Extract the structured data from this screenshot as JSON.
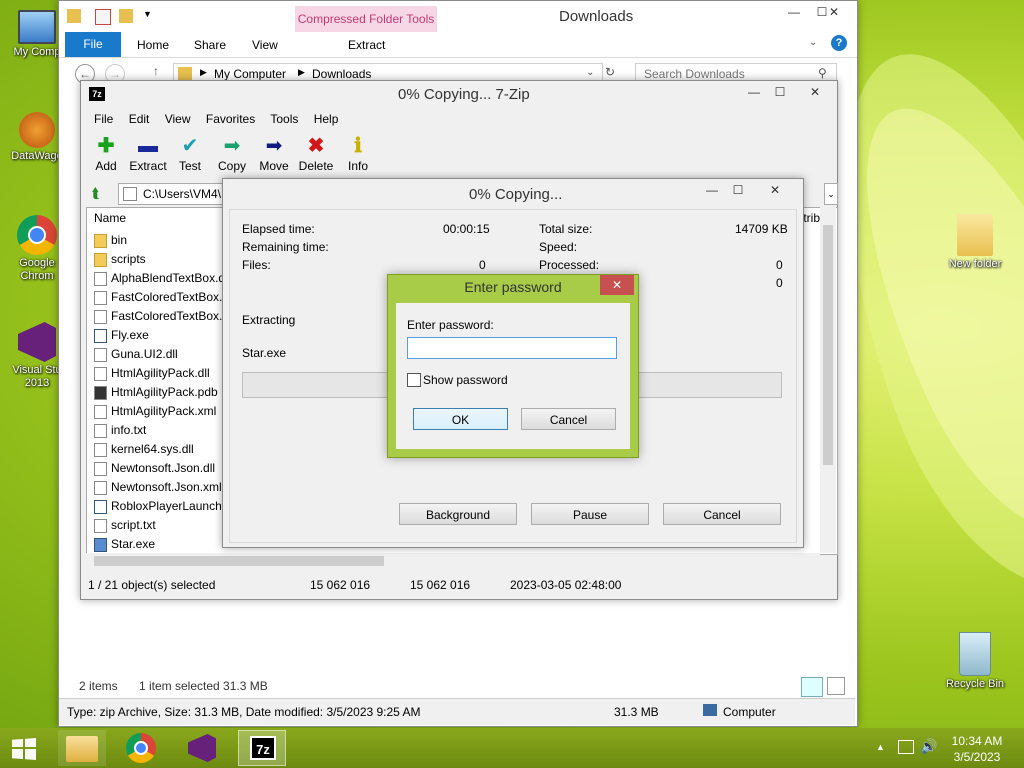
{
  "desktop": {
    "icons": [
      {
        "label": "My Comp"
      },
      {
        "label": "DataWago"
      },
      {
        "label": "Google Chrom"
      },
      {
        "label": "Visual Stu 2013"
      },
      {
        "label": "New folder"
      },
      {
        "label": "Recycle Bin"
      }
    ]
  },
  "explorer": {
    "title": "Downloads",
    "compressed_tools": "Compressed Folder Tools",
    "ribbon_tabs": [
      "File",
      "Home",
      "Share",
      "View",
      "Extract"
    ],
    "breadcrumb": [
      "My Computer",
      "Downloads"
    ],
    "search_placeholder": "Search Downloads",
    "status_items": "2 items",
    "status_selected": "1 item selected  31.3 MB",
    "details": "Type: zip Archive, Size: 31.3 MB, Date modified: 3/5/2023 9:25 AM",
    "details_size": "31.3 MB",
    "details_location": "Computer"
  },
  "sevenzip": {
    "title": "0% Copying... 7-Zip",
    "logo": "7z",
    "menu": [
      "File",
      "Edit",
      "View",
      "Favorites",
      "Tools",
      "Help"
    ],
    "toolbar": [
      {
        "label": "Add",
        "icon": "plus-icon",
        "color": "#1aa01a"
      },
      {
        "label": "Extract",
        "icon": "minus-icon",
        "color": "#1a2a9a"
      },
      {
        "label": "Test",
        "icon": "check-icon",
        "color": "#18a0b0"
      },
      {
        "label": "Copy",
        "icon": "copy-arrow-icon",
        "color": "#18a070"
      },
      {
        "label": "Move",
        "icon": "move-arrow-icon",
        "color": "#101a80"
      },
      {
        "label": "Delete",
        "icon": "x-icon",
        "color": "#d01818"
      },
      {
        "label": "Info",
        "icon": "info-icon",
        "color": "#c8b000"
      }
    ],
    "path": "C:\\Users\\VM4\\",
    "column_name": "Name",
    "column_attrib": "Attrib",
    "files": [
      {
        "name": "bin",
        "type": "folder"
      },
      {
        "name": "scripts",
        "type": "folder"
      },
      {
        "name": "AlphaBlendTextBox.d",
        "type": "dll"
      },
      {
        "name": "FastColoredTextBox.d",
        "type": "dll"
      },
      {
        "name": "FastColoredTextBox.x",
        "type": "file"
      },
      {
        "name": "Fly.exe",
        "type": "exe"
      },
      {
        "name": "Guna.UI2.dll",
        "type": "dll"
      },
      {
        "name": "HtmlAgilityPack.dll",
        "type": "dll"
      },
      {
        "name": "HtmlAgilityPack.pdb",
        "type": "pdb"
      },
      {
        "name": "HtmlAgilityPack.xml",
        "type": "file"
      },
      {
        "name": "info.txt",
        "type": "file"
      },
      {
        "name": "kernel64.sys.dll",
        "type": "dll"
      },
      {
        "name": "Newtonsoft.Json.dll",
        "type": "dll"
      },
      {
        "name": "Newtonsoft.Json.xml",
        "type": "file"
      },
      {
        "name": "RobloxPlayerLaunche",
        "type": "exe"
      },
      {
        "name": "script.txt",
        "type": "file"
      },
      {
        "name": "Star.exe",
        "type": "exe"
      }
    ],
    "status": {
      "selected": "1 / 21 object(s) selected",
      "size": "15 062 016",
      "packed": "15 062 016",
      "modified": "2023-03-05 02:48:00"
    }
  },
  "progress": {
    "title": "0% Copying...",
    "elapsed_label": "Elapsed time:",
    "elapsed_value": "00:00:15",
    "remaining_label": "Remaining time:",
    "files_label": "Files:",
    "files_value": "0",
    "total_size_label": "Total size:",
    "total_size_value": "14709 KB",
    "speed_label": "Speed:",
    "processed_label": "Processed:",
    "processed_value": "0",
    "fourth_value": "0",
    "action": "Extracting",
    "current_file": "Star.exe",
    "progress_fraction": 0,
    "background_btn": "Background",
    "pause_btn": "Pause",
    "cancel_btn": "Cancel"
  },
  "password": {
    "title": "Enter password",
    "label": "Enter password:",
    "value": "",
    "show_label": "Show password",
    "ok": "OK",
    "cancel": "Cancel"
  },
  "taskbar": {
    "time": "10:34 AM",
    "date": "3/5/2023",
    "sevenzip_label": "7z"
  }
}
